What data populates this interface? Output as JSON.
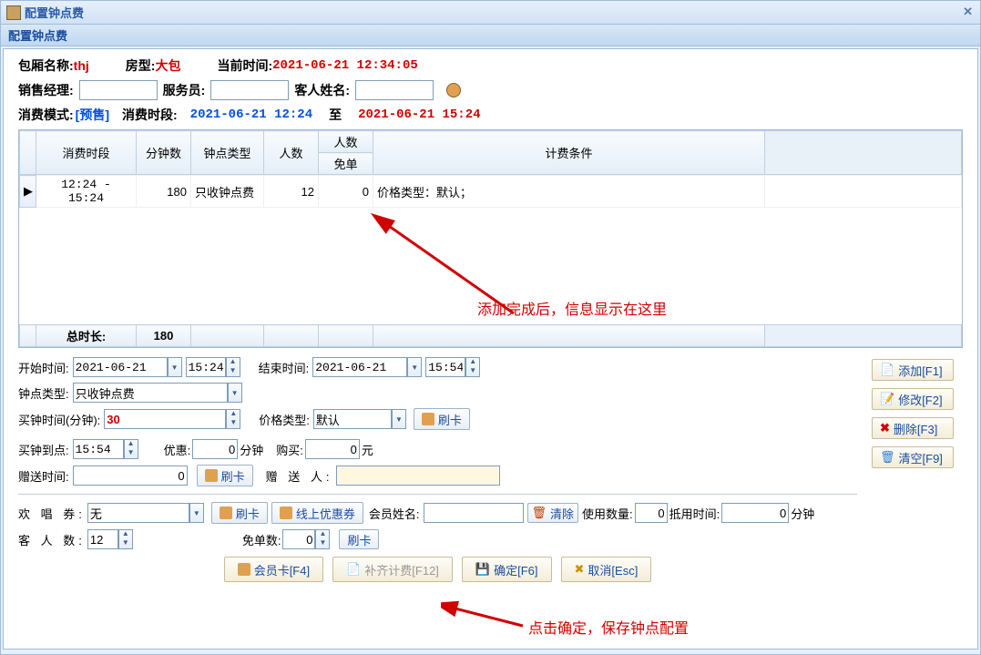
{
  "title": "配置钟点费",
  "panel_title": "配置钟点费",
  "box": {
    "name_label": "包厢名称:",
    "name": "thj",
    "room_label": "房型:",
    "room_type": "大包",
    "time_label": "当前时间:",
    "current_time": "2021-06-21 12:34:05"
  },
  "sales": {
    "mgr_label": "销售经理:",
    "mgr": "",
    "waiter_label": "服务员:",
    "waiter": "",
    "guest_label": "客人姓名:",
    "guest": ""
  },
  "mode": {
    "label": "消费模式:",
    "value": "[预售]",
    "period_label": "消费时段:",
    "start": "2021-06-21 12:24",
    "to": "至",
    "end": "2021-06-21 15:24"
  },
  "grid": {
    "headers": {
      "time": "消费时段",
      "minutes": "分钟数",
      "type": "钟点类型",
      "pcount": "人数",
      "pstack": "人数",
      "pfree": "免单",
      "cond": "计费条件"
    },
    "rows": [
      {
        "time": "12:24 - 15:24",
        "minutes": "180",
        "type": "只收钟点费",
        "pcount": "12",
        "pfree": "0",
        "cond": "价格类型：默认；"
      }
    ],
    "footer": {
      "label": "总时长:",
      "value": "180"
    }
  },
  "form": {
    "start_label": "开始时间:",
    "start_date": "2021-06-21",
    "start_time": "15:24",
    "end_label": "结束时间:",
    "end_date": "2021-06-21",
    "end_time": "15:54",
    "ctype_label": "钟点类型:",
    "ctype": "只收钟点费",
    "bought_min_label": "买钟时间(分钟):",
    "bought_min": "30",
    "price_type_label": "价格类型:",
    "price_type": "默认",
    "swipe": "刷卡",
    "until_label": "买钟到点:",
    "until_time": "15:54",
    "discount_label": "优惠:",
    "discount": "0",
    "discount_unit": "分钟",
    "amount_label": "购买:",
    "amount": "0",
    "amount_unit": "元",
    "gift_label": "赠送时间:",
    "gift": "0",
    "giver_label": "赠 送 人:",
    "giver": "",
    "coupon_label": "欢 唱 券:",
    "coupon": "无",
    "online_coupon": "线上优惠券",
    "member_name_label": "会员姓名:",
    "member_name": "",
    "clear": "清除",
    "use_count_label": "使用数量:",
    "use_count": "0",
    "offset_time_label": "抵用时间:",
    "offset_time": "0",
    "offset_unit": "分钟",
    "guest_count_label": "客 人 数:",
    "guest_count": "12",
    "free_count_label": "免单数:",
    "free_count": "0"
  },
  "sidebtns": {
    "add": "添加[F1]",
    "edit": "修改[F2]",
    "del": "删除[F3]",
    "clear": "清空[F9]"
  },
  "footerbtns": {
    "member": "会员卡[F4]",
    "fill": "补齐计费[F12]",
    "ok": "确定[F6]",
    "cancel": "取消[Esc]"
  },
  "annotations": {
    "a1": "添加完成后，信息显示在这里",
    "a2": "点击确定，保存钟点配置"
  }
}
